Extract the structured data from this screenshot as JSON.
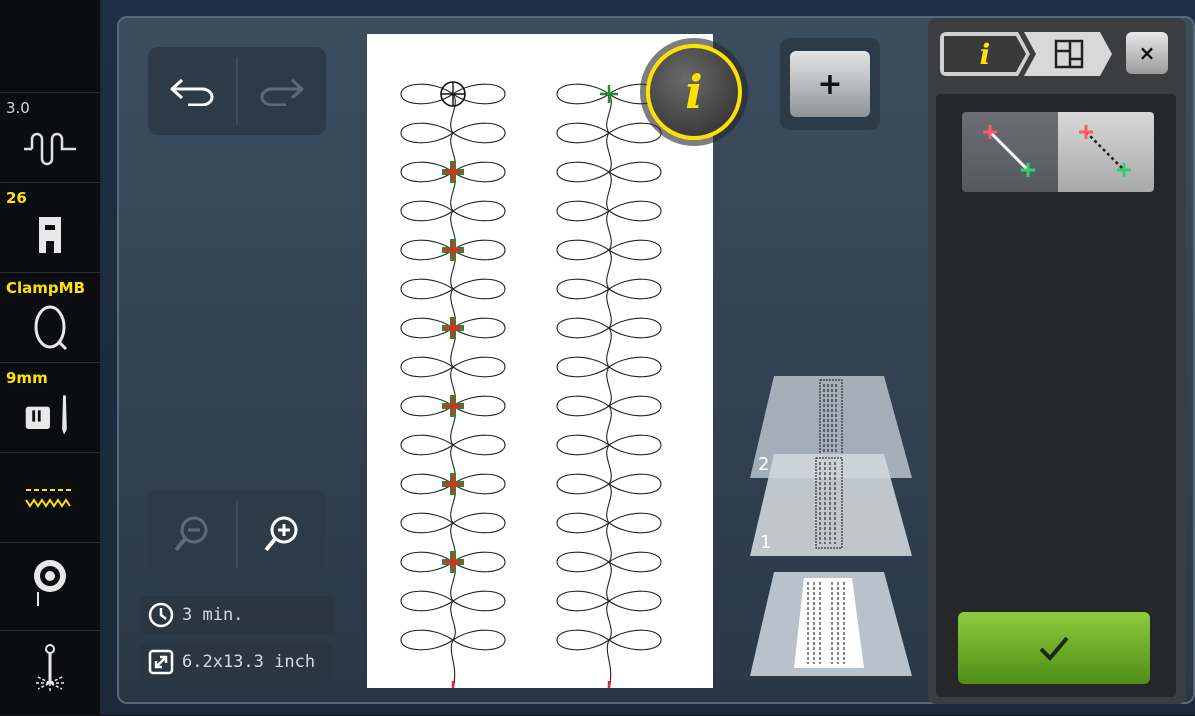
{
  "sidebar": {
    "stitch_width_label": "3.0",
    "presser_foot_label": "26",
    "hoop_label": "ClampMB",
    "needle_label": "9mm"
  },
  "info": {
    "time": "3 min.",
    "size": "6.2x13.3 inch"
  },
  "buttons": {
    "add_label": "+",
    "info_label": "i",
    "close_label": "×"
  },
  "layers": {
    "layer_2_label": "2",
    "layer_1_label": "1"
  },
  "panel": {
    "tab_info_label": "i",
    "selected_segment": "connect-points-solid"
  },
  "colors": {
    "accent": "#ffe400",
    "confirm": "#6aae28",
    "start_point": "#e8252a",
    "end_point": "#1f8f2f"
  },
  "icons": [
    "undo-icon",
    "redo-icon",
    "zoom-out-icon",
    "zoom-in-icon",
    "clock-icon",
    "resize-icon",
    "hoop-icon",
    "presser-foot-icon",
    "needle-icon",
    "stitch-icon",
    "bobbin-icon",
    "thread-icon",
    "layout-icon",
    "checkmark-icon"
  ]
}
